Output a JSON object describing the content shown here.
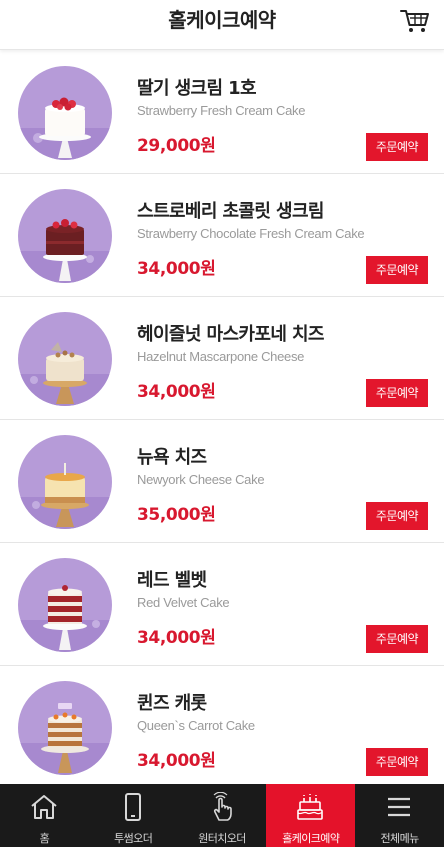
{
  "header": {
    "title": "홀케이크예약",
    "cart_icon": "cart-icon"
  },
  "colors": {
    "accent": "#e3162c",
    "price": "#d8182f",
    "nav_bg": "#1a1a1a",
    "thumb_bg": "#b49ad6"
  },
  "items": [
    {
      "name": "딸기 생크림 1호",
      "en": "Strawberry Fresh Cream Cake",
      "price": "29,000원",
      "button": "주문예약"
    },
    {
      "name": "스트로베리 초콜릿 생크림",
      "en": "Strawberry Chocolate Fresh Cream Cake",
      "price": "34,000원",
      "button": "주문예약"
    },
    {
      "name": "헤이즐넛 마스카포네 치즈",
      "en": "Hazelnut Mascarpone Cheese",
      "price": "34,000원",
      "button": "주문예약"
    },
    {
      "name": "뉴욕 치즈",
      "en": "Newyork Cheese Cake",
      "price": "35,000원",
      "button": "주문예약"
    },
    {
      "name": "레드 벨벳",
      "en": "Red Velvet Cake",
      "price": "34,000원",
      "button": "주문예약"
    },
    {
      "name": "퀸즈 캐롯",
      "en": "Queen`s Carrot Cake",
      "price": "34,000원",
      "button": "주문예약"
    }
  ],
  "nav": [
    {
      "label": "홈",
      "icon": "home-icon"
    },
    {
      "label": "투썸오더",
      "icon": "phone-icon"
    },
    {
      "label": "원터치오더",
      "icon": "touch-hand-icon"
    },
    {
      "label": "홀케이크예약",
      "icon": "birthday-cake-icon",
      "active": true
    },
    {
      "label": "전체메뉴",
      "icon": "menu-icon"
    }
  ]
}
